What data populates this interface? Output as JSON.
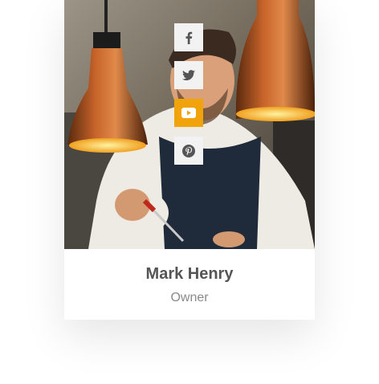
{
  "member": {
    "name": "Mark Henry",
    "role": "Owner"
  },
  "social": [
    {
      "network": "facebook",
      "icon": "facebook-icon"
    },
    {
      "network": "twitter",
      "icon": "twitter-icon"
    },
    {
      "network": "youtube",
      "icon": "youtube-icon",
      "active": true
    },
    {
      "network": "pinterest",
      "icon": "pinterest-icon"
    }
  ],
  "colors": {
    "accent": "#f0a30a",
    "name": "#555555",
    "role": "#8a8a8a",
    "icon": "#555555"
  }
}
